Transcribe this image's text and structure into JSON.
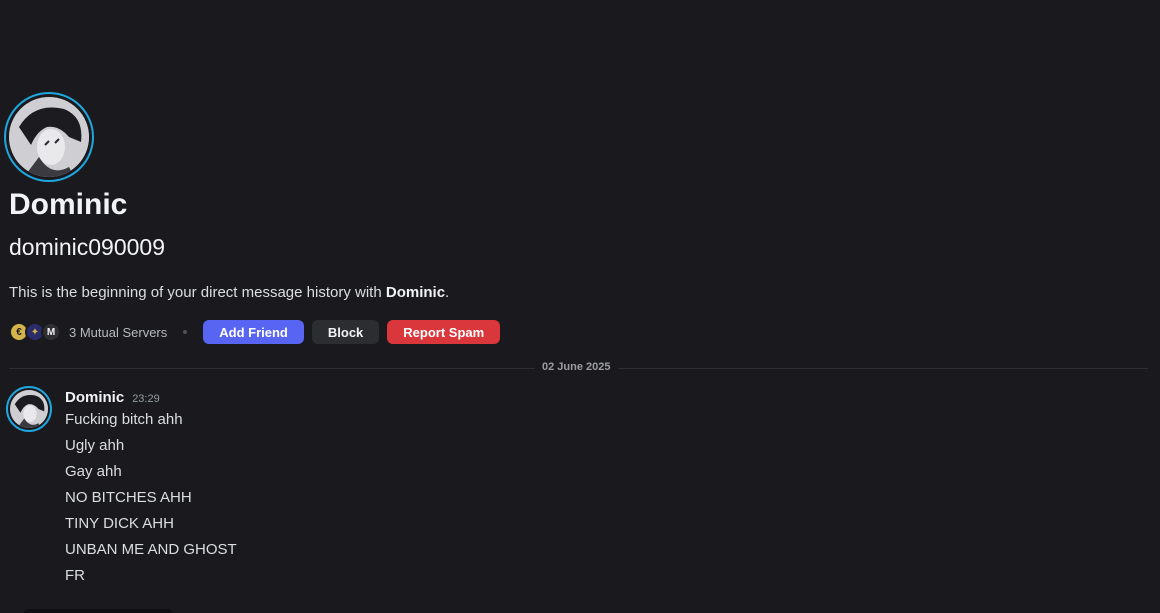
{
  "profile": {
    "display_name": "Dominic",
    "username": "dominic090009",
    "avatar_icon": "user-avatar-icon",
    "ring_color": "#1fa6e0"
  },
  "intro": {
    "prefix": "This is the beginning of your direct message history with ",
    "name": "Dominic",
    "suffix": "."
  },
  "actions": {
    "server_icons": [
      {
        "icon": "server-icon-coin",
        "glyph": "€"
      },
      {
        "icon": "server-icon-crest",
        "glyph": "✦"
      },
      {
        "icon": "server-icon-m",
        "glyph": "M"
      }
    ],
    "mutual_servers": "3 Mutual Servers",
    "add_friend": "Add Friend",
    "block": "Block",
    "report_spam": "Report Spam",
    "colors": {
      "add_friend": "#5865f2",
      "block": "#2b2d31",
      "report_spam": "#da373c"
    }
  },
  "divider": {
    "date": "02 June 2025"
  },
  "message": {
    "author": "Dominic",
    "time": "23:29",
    "lines": [
      "Fucking bitch ahh",
      "Ugly ahh",
      "Gay ahh",
      "NO BITCHES AHH",
      "TINY DICK AHH",
      "UNBAN ME AND GHOST",
      "FR"
    ]
  }
}
